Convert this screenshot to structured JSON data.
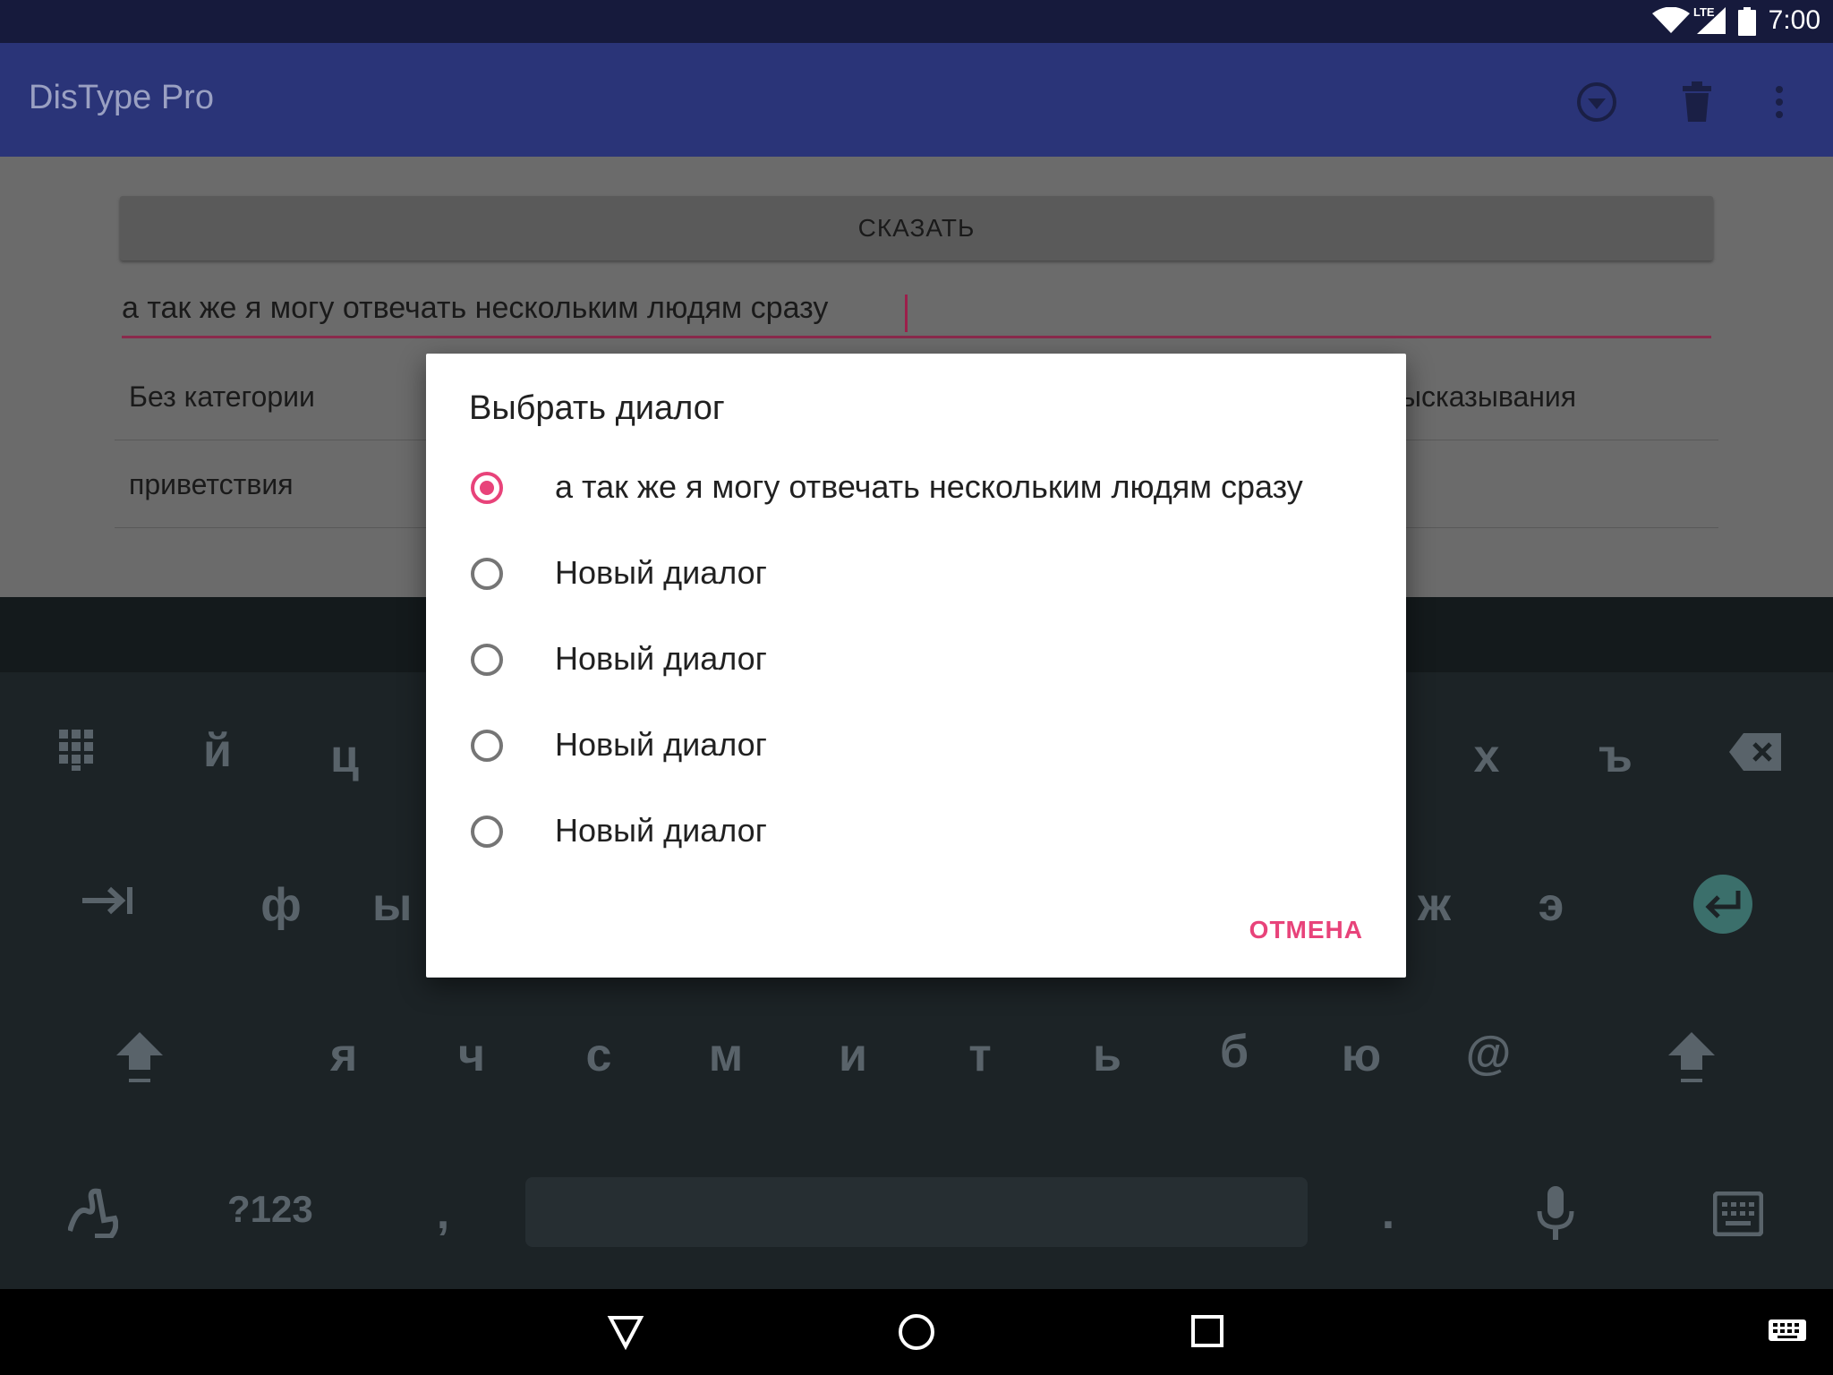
{
  "status": {
    "time": "7:00",
    "network": "LTE"
  },
  "app": {
    "title": "DisType Pro"
  },
  "main": {
    "say_button": "СКАЗАТЬ",
    "input_text": "а так же я могу отвечать нескольким людям сразу",
    "categories": [
      {
        "label": "Без категории"
      },
      {
        "label": "высказывания"
      },
      {
        "label": "приветствия"
      }
    ]
  },
  "dialog": {
    "title": "Выбрать диалог",
    "options": [
      {
        "label": "а так же я могу отвечать нескольким людям сразу",
        "selected": true
      },
      {
        "label": "Новый диалог",
        "selected": false
      },
      {
        "label": "Новый диалог",
        "selected": false
      },
      {
        "label": "Новый диалог",
        "selected": false
      },
      {
        "label": "Новый диалог",
        "selected": false
      }
    ],
    "cancel": "ОТМЕНА"
  },
  "keyboard": {
    "row1": [
      "й",
      "ц",
      "х",
      "ъ"
    ],
    "row2": [
      "ф",
      "ы",
      "ж",
      "э"
    ],
    "row3": [
      "я",
      "ч",
      "с",
      "м",
      "и",
      "т",
      "ь",
      "б",
      "ю",
      "@"
    ],
    "row4": {
      "symbols": "?123",
      "comma": ",",
      "period": "."
    }
  },
  "colors": {
    "accent": "#e8437a",
    "primary": "#2a3478",
    "status_bar": "#161a3c"
  }
}
